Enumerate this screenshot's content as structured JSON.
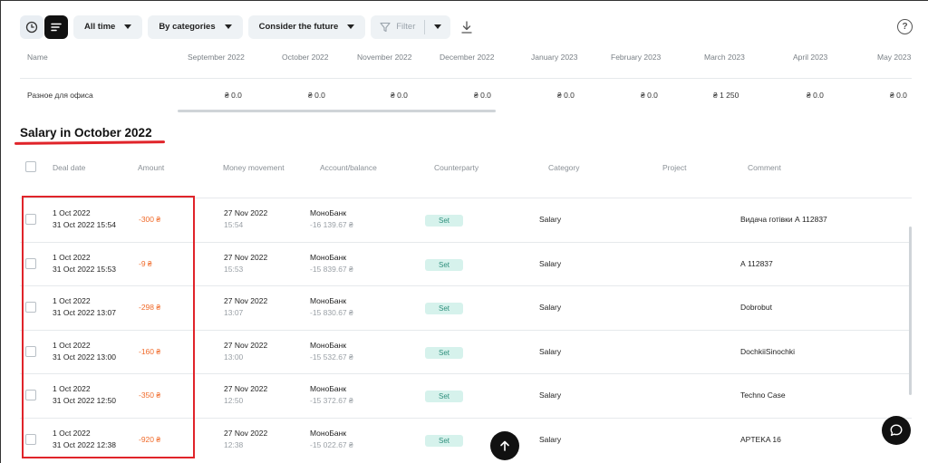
{
  "toolbar": {
    "period_label": "All time",
    "grouping_label": "By categories",
    "future_label": "Consider the future",
    "filter_label": "Filter"
  },
  "icons": {
    "clock": "clock-icon",
    "list": "list-icon",
    "filter": "filter-icon",
    "download": "download-icon",
    "help": "help-icon",
    "scroll_up": "arrow-up-icon",
    "chat": "chat-icon"
  },
  "help_glyph": "?",
  "monthly": {
    "name_header": "Name",
    "months": [
      "September 2022",
      "October 2022",
      "November 2022",
      "December 2022",
      "January 2023",
      "February 2023",
      "March 2023",
      "April 2023",
      "May 2023"
    ],
    "row_name": "Разное для офиса",
    "values": [
      "₴ 0.0",
      "₴ 0.0",
      "₴ 0.0",
      "₴ 0.0",
      "₴ 0.0",
      "₴ 0.0",
      "₴ 1 250",
      "₴ 0.0",
      "₴ 0.0"
    ]
  },
  "section_title": "Salary in October 2022",
  "columns": {
    "deal_date": "Deal date",
    "amount": "Amount",
    "money_movement": "Money movement",
    "account": "Account/balance",
    "counterparty": "Counterparty",
    "category": "Category",
    "project": "Project",
    "comment": "Comment"
  },
  "rows": [
    {
      "deal_date": "1 Oct 2022",
      "deal_datetime": "31 Oct 2022 15:54",
      "amount": "-300 ₴",
      "move_date": "27 Nov 2022",
      "move_time": "15:54",
      "account": "МоноБанк",
      "balance": "-16 139.67 ₴",
      "counterparty": "Set",
      "category": "Salary",
      "comment": "Видача готівки А 112837"
    },
    {
      "deal_date": "1 Oct 2022",
      "deal_datetime": "31 Oct 2022 15:53",
      "amount": "-9 ₴",
      "move_date": "27 Nov 2022",
      "move_time": "15:53",
      "account": "МоноБанк",
      "balance": "-15 839.67 ₴",
      "counterparty": "Set",
      "category": "Salary",
      "comment": "А 112837"
    },
    {
      "deal_date": "1 Oct 2022",
      "deal_datetime": "31 Oct 2022 13:07",
      "amount": "-298 ₴",
      "move_date": "27 Nov 2022",
      "move_time": "13:07",
      "account": "МоноБанк",
      "balance": "-15 830.67 ₴",
      "counterparty": "Set",
      "category": "Salary",
      "comment": "Dobrobut"
    },
    {
      "deal_date": "1 Oct 2022",
      "deal_datetime": "31 Oct 2022 13:00",
      "amount": "-160 ₴",
      "move_date": "27 Nov 2022",
      "move_time": "13:00",
      "account": "МоноБанк",
      "balance": "-15 532.67 ₴",
      "counterparty": "Set",
      "category": "Salary",
      "comment": "DochkiiSinochki"
    },
    {
      "deal_date": "1 Oct 2022",
      "deal_datetime": "31 Oct 2022 12:50",
      "amount": "-350 ₴",
      "move_date": "27 Nov 2022",
      "move_time": "12:50",
      "account": "МоноБанк",
      "balance": "-15 372.67 ₴",
      "counterparty": "Set",
      "category": "Salary",
      "comment": "Techno Case"
    },
    {
      "deal_date": "1 Oct 2022",
      "deal_datetime": "31 Oct 2022 12:38",
      "amount": "-920 ₴",
      "move_date": "27 Nov 2022",
      "move_time": "12:38",
      "account": "МоноБанк",
      "balance": "-15 022.67 ₴",
      "counterparty": "Set",
      "category": "Salary",
      "comment": "APTEKA 16"
    }
  ]
}
